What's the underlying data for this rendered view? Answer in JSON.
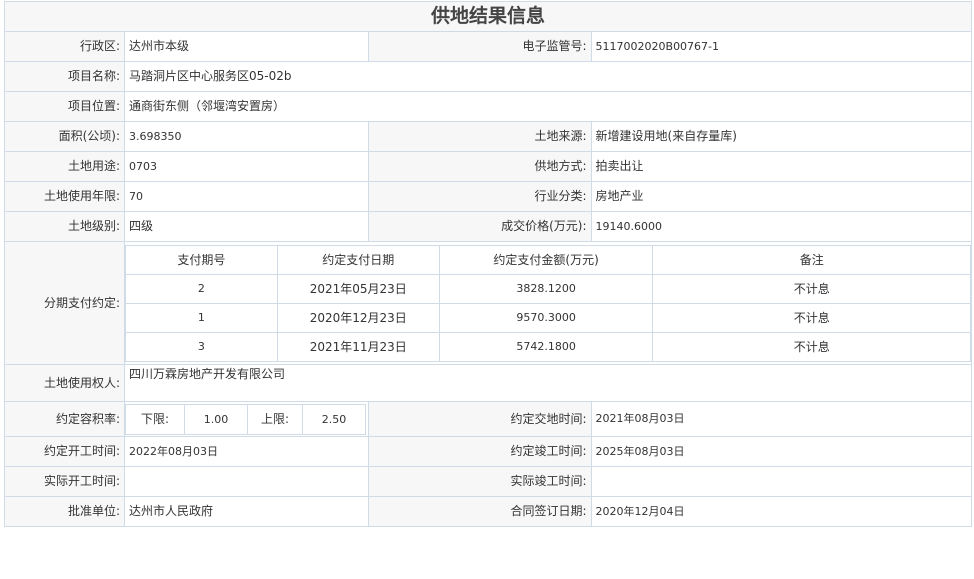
{
  "title": "供地结果信息",
  "fields": {
    "admin_region": {
      "label": "行政区:",
      "value": "达州市本级"
    },
    "e_code": {
      "label": "电子监管号:",
      "value": "5117002020B00767-1"
    },
    "project_name": {
      "label": "项目名称:",
      "value": "马踏洞片区中心服务区05-02b"
    },
    "project_location": {
      "label": "项目位置:",
      "value": "通商街东侧（邻堰湾安置房）"
    },
    "area": {
      "label": "面积(公顷):",
      "value": "3.698350"
    },
    "land_source": {
      "label": "土地来源:",
      "value": "新增建设用地(来自存量库)"
    },
    "land_use": {
      "label": "土地用途:",
      "value": "0703"
    },
    "supply_method": {
      "label": "供地方式:",
      "value": "拍卖出让"
    },
    "use_years": {
      "label": "土地使用年限:",
      "value": "70"
    },
    "industry": {
      "label": "行业分类:",
      "value": "房地产业"
    },
    "land_grade": {
      "label": "土地级别:",
      "value": "四级"
    },
    "deal_price": {
      "label": "成交价格(万元):",
      "value": "19140.6000"
    },
    "installment": {
      "label": "分期支付约定:"
    },
    "land_user": {
      "label": "土地使用权人:",
      "value": "四川万霖房地产开发有限公司"
    },
    "far": {
      "label": "约定容积率:",
      "lower_label": "下限:",
      "lower": "1.00",
      "upper_label": "上限:",
      "upper": "2.50"
    },
    "delivery_time": {
      "label": "约定交地时间:",
      "value": "2021年08月03日"
    },
    "start_time": {
      "label": "约定开工时间:",
      "value": "2022年08月03日"
    },
    "finish_time": {
      "label": "约定竣工时间:",
      "value": "2025年08月03日"
    },
    "actual_start": {
      "label": "实际开工时间:",
      "value": ""
    },
    "actual_finish": {
      "label": "实际竣工时间:",
      "value": ""
    },
    "approval_unit": {
      "label": "批准单位:",
      "value": "达州市人民政府"
    },
    "contract_date": {
      "label": "合同签订日期:",
      "value": "2020年12月04日"
    }
  },
  "payments": {
    "headers": [
      "支付期号",
      "约定支付日期",
      "约定支付金额(万元)",
      "备注"
    ],
    "rows": [
      [
        "2",
        "2021年05月23日",
        "3828.1200",
        "不计息"
      ],
      [
        "1",
        "2020年12月23日",
        "9570.3000",
        "不计息"
      ],
      [
        "3",
        "2021年11月23日",
        "5742.1800",
        "不计息"
      ]
    ]
  }
}
